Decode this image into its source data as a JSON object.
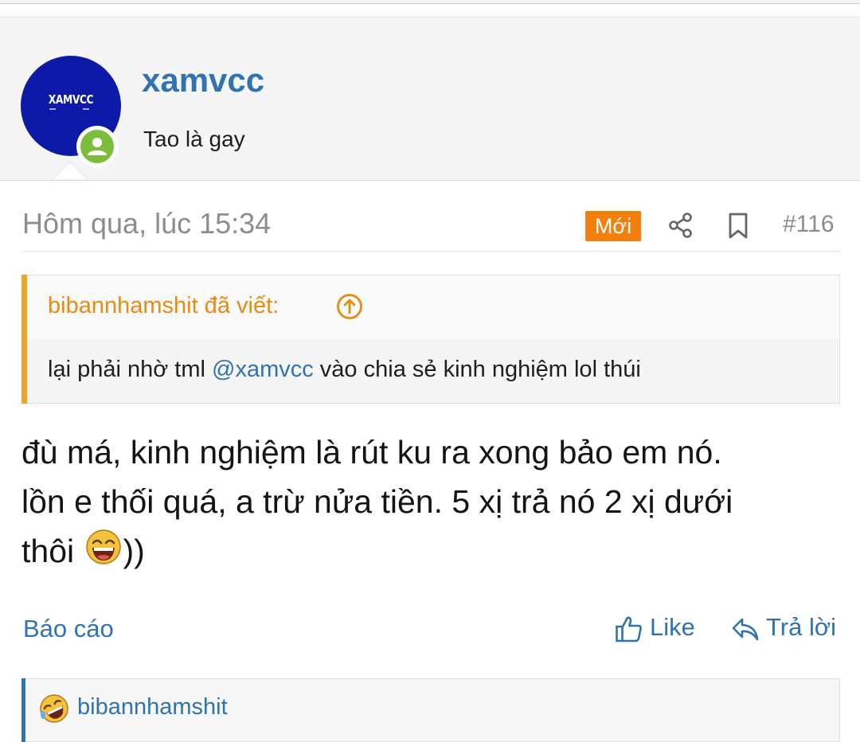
{
  "post_header": {
    "username": "xamvcc",
    "user_title": "Tao là gay",
    "avatar_text": "XAMVCC",
    "avatar_bg": "#0d1aa8",
    "online_color": "#7cbd3c"
  },
  "meta": {
    "timestamp": "Hôm qua, lúc 15:34",
    "new_badge": "Mới",
    "post_number": "#116",
    "icons": [
      "share-icon",
      "bookmark-icon"
    ]
  },
  "quote": {
    "author": "bibannhamshit đã viết:",
    "text_before": "lại phải nhờ tml ",
    "mention": "@xamvcc",
    "text_after": " vào chia sẻ kinh nghiệm lol thúi"
  },
  "body": {
    "line1": "đù má, kinh nghiệm là rút ku ra xong bảo em nó.",
    "line2": "lồn e thối quá, a trừ nửa tiền. 5 xị trả nó 2 xị dưới",
    "line3_before": "thôi ",
    "line3_after": "))",
    "emoji": "laughing-emoji"
  },
  "actions": {
    "report": "Báo cáo",
    "like": "Like",
    "reply": "Trả lời"
  },
  "reactions": {
    "user": "bibannhamshit",
    "emoji": "rofl-emoji"
  },
  "colors": {
    "link": "#2f73b1",
    "accent_orange": "#f3800c",
    "quote_bar": "#f3a127"
  }
}
